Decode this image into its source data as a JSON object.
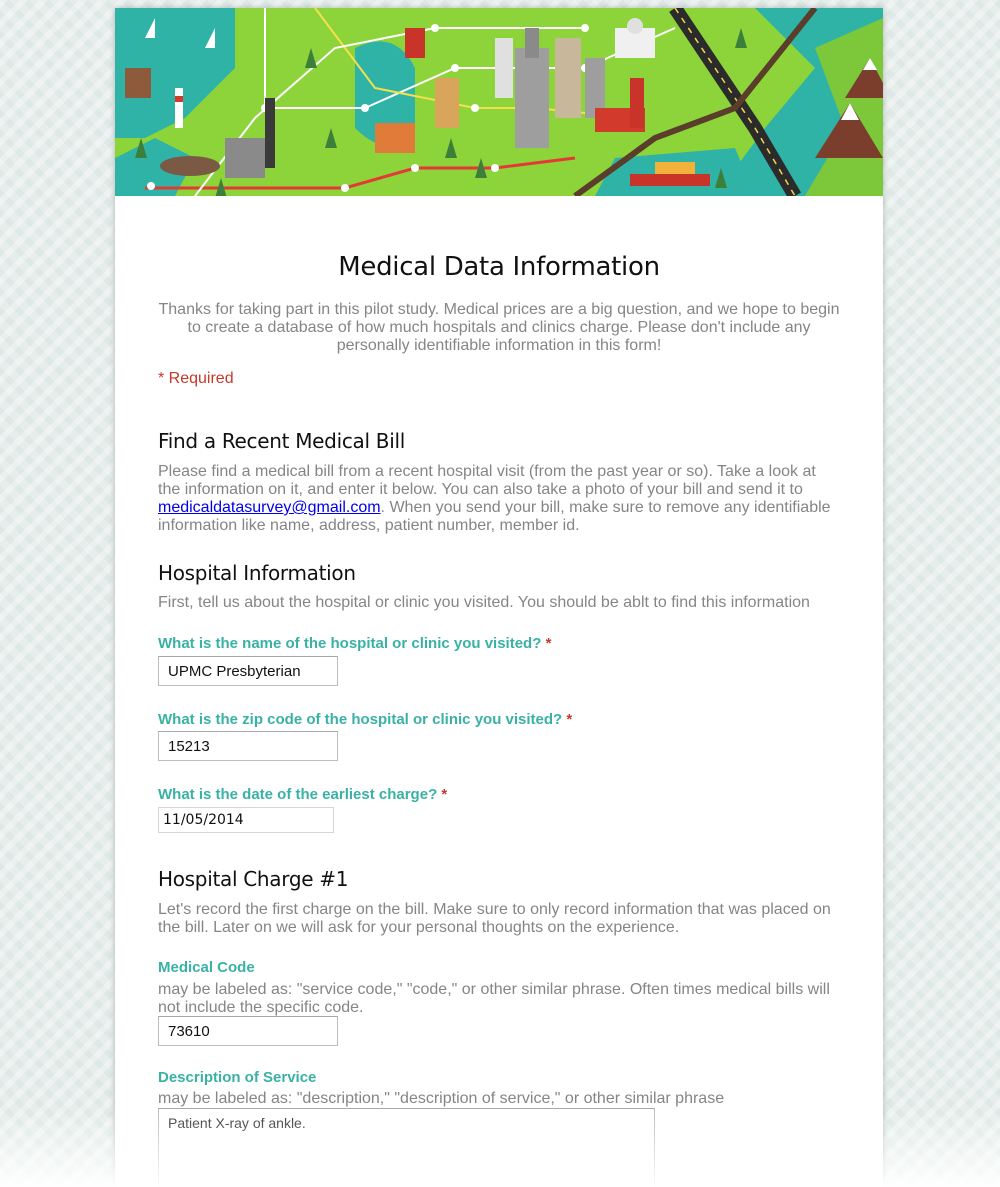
{
  "form": {
    "title": "Medical Data Information",
    "description": "Thanks for taking part in this pilot study. Medical prices are a big question, and we hope to begin to create a database of how much hospitals and clinics charge. Please don't include any personally identifiable information in this form!",
    "required_note": "* Required"
  },
  "sections": {
    "bill": {
      "title": "Find a Recent Medical Bill",
      "desc_before": "Please find a medical bill from a recent hospital visit (from the past year or so). Take a look at the information on it, and enter it below.  You can also take a photo of your bill and send it to ",
      "email": "medicaldatasurvey@gmail.com",
      "desc_after": ". When you send your bill, make sure to remove any identifiable information like name, address, patient number, member id."
    },
    "hospital": {
      "title": "Hospital Information",
      "desc": "First, tell us about the hospital or clinic you visited. You should be ablt to find this information"
    },
    "charge": {
      "title": "Hospital Charge #1",
      "desc": "Let's record the first charge on the bill. Make sure to only record information that was placed on the bill. Later on we will ask for your personal thoughts on the experience."
    }
  },
  "questions": {
    "hospital_name": {
      "label": "What is the name of the hospital or clinic you visited?",
      "required_mark": "*",
      "value": "UPMC Presbyterian"
    },
    "zip": {
      "label": "What is the zip code of the hospital or clinic you visited?",
      "required_mark": "*",
      "value": "15213"
    },
    "date": {
      "label": "What is the date of the earliest charge?",
      "required_mark": "*",
      "value": "11/05/2014"
    },
    "medical_code": {
      "label": "Medical Code",
      "help": "may be labeled as: \"service code,\" \"code,\" or other similar phrase. Often times medical bills will not include the specific code.",
      "value": "73610"
    },
    "description": {
      "label": "Description of Service",
      "help": "may be labeled as: \"description,\" \"description of service,\" or other similar phrase",
      "value": "Patient X-ray of ankle."
    }
  },
  "colors": {
    "accent": "#3ab1a5",
    "required": "#c53929",
    "muted_text": "#858585",
    "banner_green": "#8cd43a",
    "banner_water": "#2fb3a6"
  }
}
